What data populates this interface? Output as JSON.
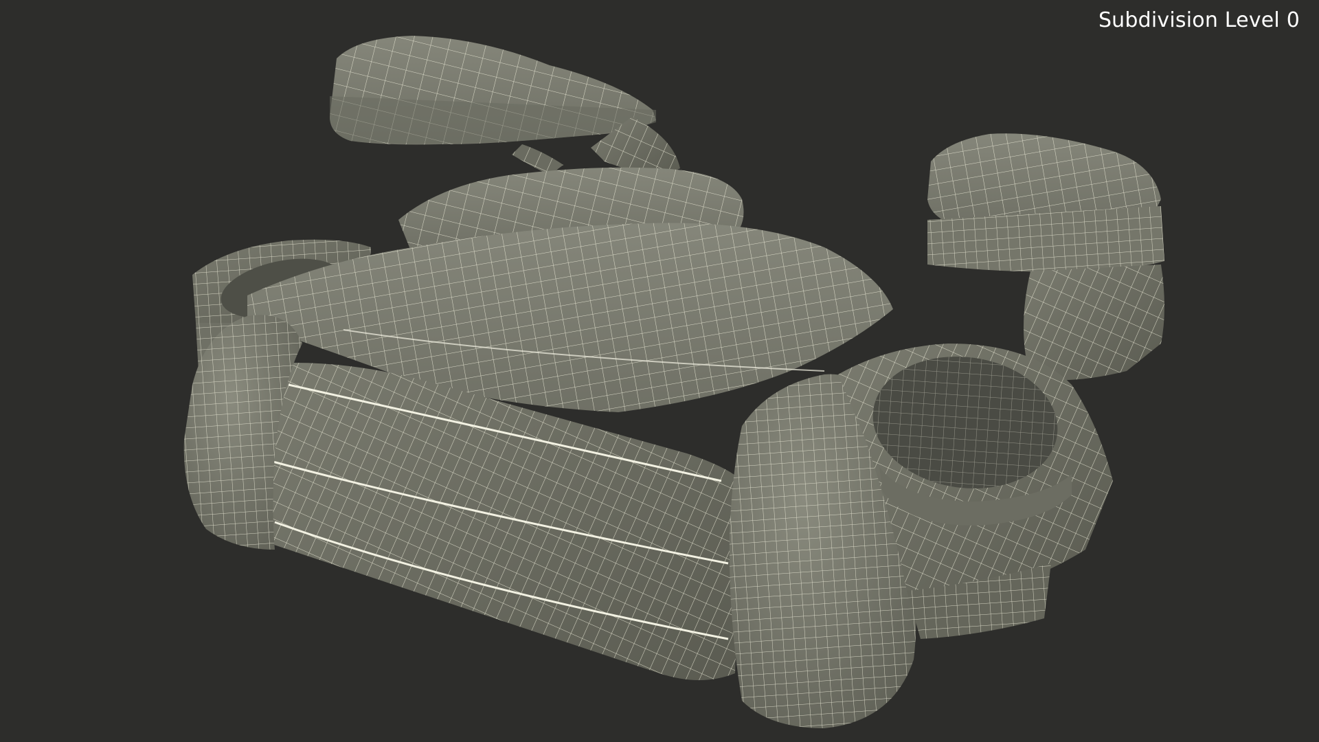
{
  "viewport": {
    "background_color": "#2d2d2b",
    "subdivision_label": "Subdivision Level 0"
  },
  "model": {
    "subject": "booster-seat-wireframe",
    "surface_color": "#7b7c70",
    "shadow_color": "#585a50",
    "wire_color": "#ecebd9",
    "parts": [
      "left-armrest",
      "right-armrest",
      "backrest",
      "seat-cushion",
      "left-cupholder",
      "right-cupholder",
      "front-bolster-left",
      "front-bolster-right"
    ]
  }
}
